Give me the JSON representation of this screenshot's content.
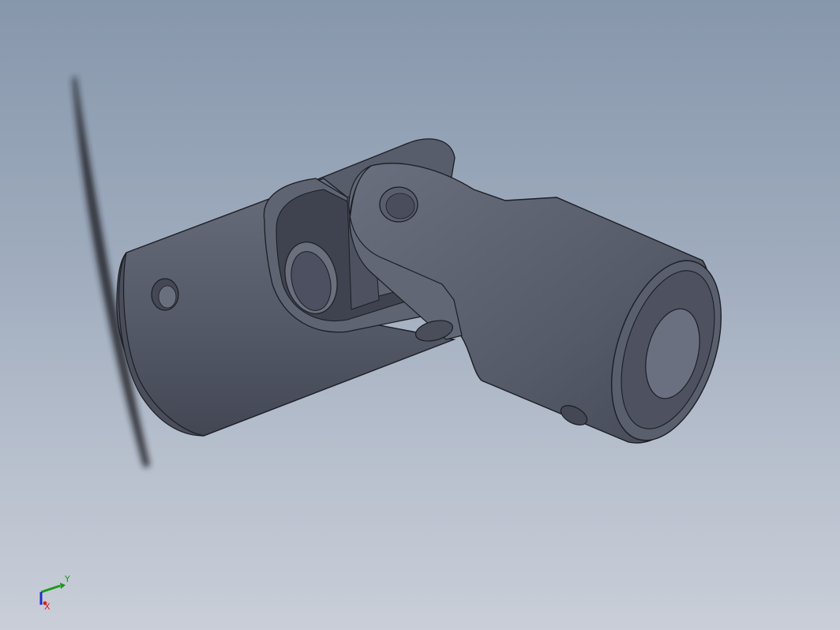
{
  "viewport": {
    "background_top": "#8797ab",
    "background_bottom": "#c9ced8",
    "model": {
      "type": "universal-joint",
      "body_color": "#5c6170",
      "edge_color": "#1c1e24"
    }
  },
  "triad": {
    "y_label": "Y",
    "x_label": "X",
    "y_color": "#1a9a1a",
    "x_color": "#d42020",
    "z_color": "#2030c8"
  }
}
